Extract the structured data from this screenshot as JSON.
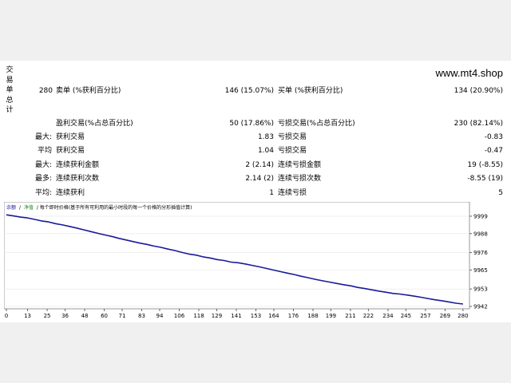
{
  "side_label": [
    "交",
    "易",
    "单",
    "总",
    "计"
  ],
  "site": "www.mt4.shop",
  "stats": {
    "count": "280",
    "sell_label": "卖单 (%获利百分比)",
    "sell_value": "146 (15.07%)",
    "buy_label": "买单 (%获利百分比)",
    "buy_value": "134 (20.90%)",
    "profit_trades_label": "盈利交易(%占总百分比)",
    "profit_trades_value": "50 (17.86%)",
    "loss_trades_label": "亏损交易(%占总百分比)",
    "loss_trades_value": "230 (82.14%)",
    "rows": [
      {
        "prefix": "最大:",
        "l_label": "获利交易",
        "l_value": "1.83",
        "r_label": "亏损交易",
        "r_value": "-0.83"
      },
      {
        "prefix": "平均",
        "l_label": "获利交易",
        "l_value": "1.04",
        "r_label": "亏损交易",
        "r_value": "-0.47"
      },
      {
        "prefix": "最大:",
        "l_label": "连续获利金额",
        "l_value": "2 (2.14)",
        "r_label": "连续亏损金额",
        "r_value": "19 (-8.55)"
      },
      {
        "prefix": "最多:",
        "l_label": "连续获利次数",
        "l_value": "2.14 (2)",
        "r_label": "连续亏损次数",
        "r_value": "-8.55 (19)"
      },
      {
        "prefix": "平均:",
        "l_label": "连续获利",
        "l_value": "1",
        "r_label": "连续亏损",
        "r_value": "5"
      }
    ]
  },
  "chart_legend": {
    "balance": "余额",
    "sep": "/",
    "equity": "净值",
    "rest": "/ 每个即时价格(基于所有可利用的最小时段的每一个价格的分形插值计算)"
  },
  "colors": {
    "line": "#1a1a9a",
    "legend_balance": "#1a1a9a",
    "legend_equity": "#1a8a1a"
  },
  "chart_data": {
    "type": "line",
    "series": [
      {
        "values": [
          9999.9,
          9999.2,
          9998.4,
          9997.9,
          9997.0,
          9996.0,
          9995.4,
          9994.3,
          9993.5,
          9992.5,
          9991.5,
          9990.4,
          9989.3,
          9988.2,
          9987.2,
          9986.2,
          9985.0,
          9984.0,
          9983.0,
          9982.0,
          9981.2,
          9980.1,
          9979.3,
          9978.2,
          9977.3,
          9976.1,
          9975.1,
          9974.4,
          9973.3,
          9972.6,
          9971.6,
          9971.0,
          9970.0,
          9969.6,
          9968.8,
          9967.9,
          9967.0,
          9966.0,
          9965.0,
          9964.0,
          9963.0,
          9962.1,
          9961.0,
          9960.1,
          9959.1,
          9958.2,
          9957.4,
          9956.5,
          9955.7,
          9955.0,
          9954.0,
          9953.3,
          9952.5,
          9951.7,
          9951.0,
          9950.2,
          9949.8,
          9949.2,
          9948.5,
          9947.8,
          9947.0,
          9946.2,
          9945.6,
          9944.8,
          9944.0,
          9943.5
        ]
      }
    ],
    "x_ticks": [
      "0",
      "13",
      "25",
      "36",
      "48",
      "60",
      "71",
      "83",
      "94",
      "106",
      "118",
      "129",
      "141",
      "153",
      "164",
      "176",
      "188",
      "199",
      "211",
      "222",
      "234",
      "245",
      "257",
      "269",
      "280"
    ],
    "y_ticks": [
      "9999",
      "9988",
      "9976",
      "9965",
      "9953",
      "9942"
    ],
    "xlim": [
      0,
      283
    ],
    "ylim": [
      9942,
      10002
    ]
  }
}
